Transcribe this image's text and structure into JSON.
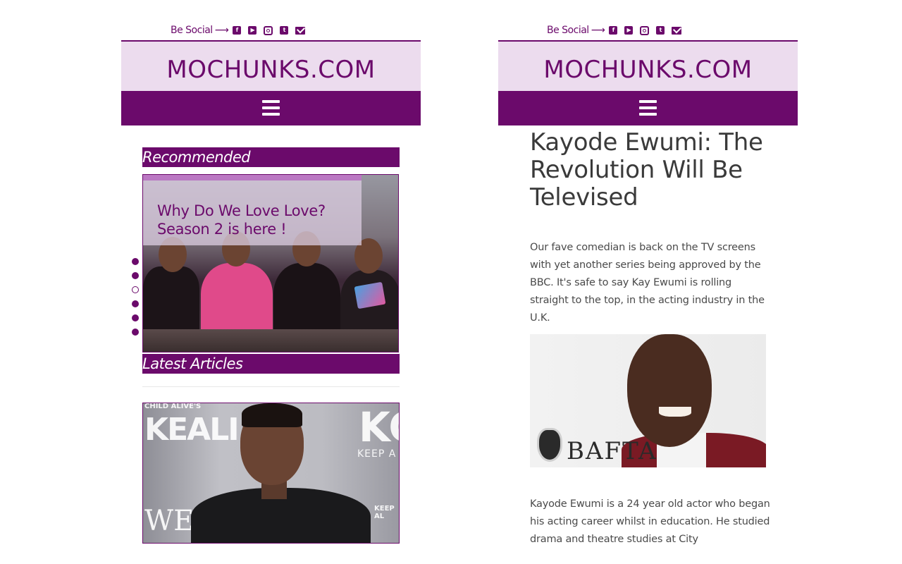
{
  "left": {
    "social": {
      "label": "Be Social",
      "arrow": "⟶",
      "icons": [
        "facebook-icon",
        "youtube-icon",
        "instagram-icon",
        "twitter-icon",
        "mail-icon"
      ]
    },
    "brand": "MOCHUNKS.COM",
    "recommended_heading": "Recommended",
    "slider": {
      "caption": "Why Do We Love Love? Season 2 is here !",
      "dots": [
        true,
        true,
        false,
        true,
        true,
        true
      ]
    },
    "latest_heading": "Latest Articles",
    "article_image_text": {
      "a": "CHILD ALIVE'S",
      "b": "KEALI",
      "c": "KC",
      "d": "KEEP A",
      "e": "WE",
      "f": "KEEP AL"
    }
  },
  "right": {
    "social": {
      "label": "Be Social",
      "arrow": "⟶",
      "icons": [
        "facebook-icon",
        "youtube-icon",
        "instagram-icon",
        "twitter-icon",
        "mail-icon"
      ]
    },
    "brand": "MOCHUNKS.COM",
    "article": {
      "title": "Kayode Ewumi: The Revolution Will Be Televised",
      "intro": "Our fave comedian is back on the TV screens with yet another series being approved by the BBC. It's safe to say Kay Ewumi is rolling straight to the top, in the acting industry in the U.K.",
      "image_text": "BAFTA",
      "body": "Kayode Ewumi is a 24 year old actor who began his acting career whilst in education. He studied drama and theatre studies at City"
    }
  },
  "colors": {
    "brand_purple": "#6b0a6b",
    "brand_light": "#ecdcee",
    "text": "#4a4a4a"
  }
}
